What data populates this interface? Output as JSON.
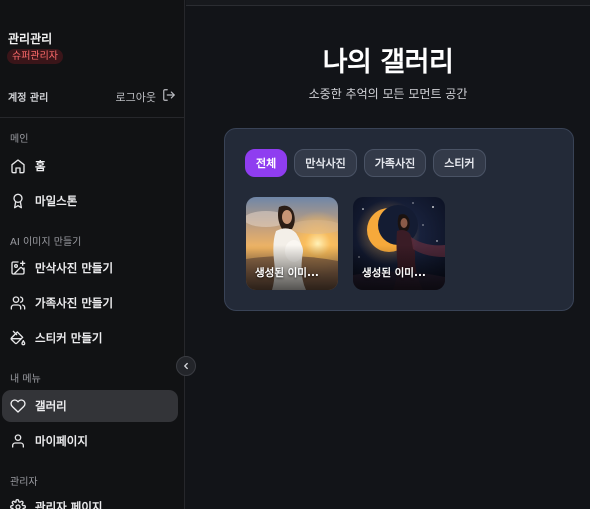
{
  "user": {
    "name": "관리관리",
    "role": "슈퍼관리자"
  },
  "account": {
    "label": "계정 관리",
    "logout": "로그아웃"
  },
  "sidebar": {
    "sections": [
      {
        "label": "메인"
      },
      {
        "label": "AI 이미지 만들기"
      },
      {
        "label": "내 메뉴"
      },
      {
        "label": "관리자"
      }
    ],
    "items": [
      {
        "label": "홈",
        "icon": "home-icon"
      },
      {
        "label": "마일스톤",
        "icon": "award-icon"
      },
      {
        "label": "만삭사진 만들기",
        "icon": "image-plus-icon"
      },
      {
        "label": "가족사진 만들기",
        "icon": "users-icon"
      },
      {
        "label": "스티커 만들기",
        "icon": "paint-bucket-icon"
      },
      {
        "label": "갤러리",
        "icon": "heart-icon",
        "active": true
      },
      {
        "label": "마이페이지",
        "icon": "user-icon"
      },
      {
        "label": "관리자 페이지",
        "icon": "settings-icon"
      }
    ]
  },
  "main": {
    "title": "나의 갤러리",
    "subtitle": "소중한 추억의 모든 모먼트 공간",
    "filters": [
      {
        "label": "전체",
        "active": true
      },
      {
        "label": "만삭사진"
      },
      {
        "label": "가족사진"
      },
      {
        "label": "스티커"
      }
    ],
    "images": [
      {
        "label": "생성된 이미..."
      },
      {
        "label": "생성된 이미..."
      }
    ]
  },
  "colors": {
    "accent": "#8f3df0",
    "role_badge": "#ff6b6b",
    "card_bg": "#232a38"
  }
}
